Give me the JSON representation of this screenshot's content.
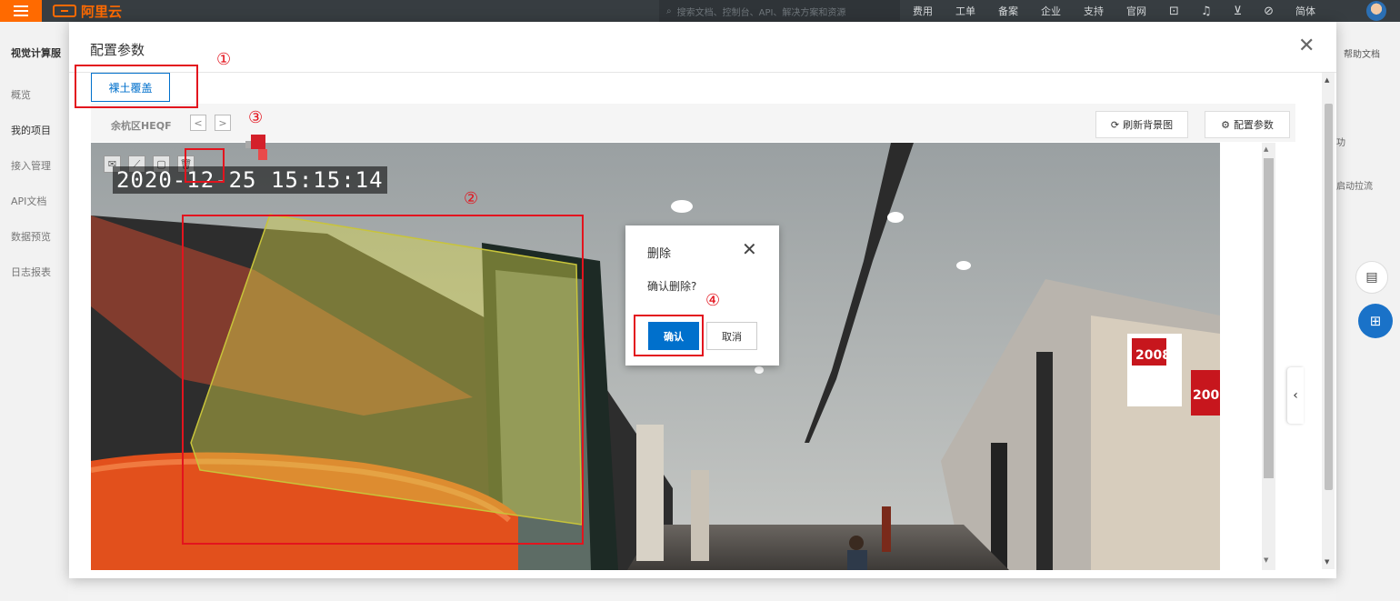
{
  "topbar": {
    "logo_text": "阿里云",
    "search_placeholder": "搜索文档、控制台、API、解决方案和资源",
    "nav": [
      "费用",
      "工单",
      "备案",
      "企业",
      "支持",
      "官网"
    ],
    "icons": [
      "terminal-icon",
      "bell-icon",
      "cart-icon",
      "help-icon"
    ],
    "lang": "简体"
  },
  "sidebar": {
    "title": "视觉计算服",
    "items": [
      "概览",
      "我的项目",
      "接入管理",
      "API文档",
      "数据预览",
      "日志报表"
    ],
    "active_index": 1
  },
  "right_panel": {
    "help": "帮助文档",
    "text1": "功",
    "text2": "启动拉流"
  },
  "dialog": {
    "title": "配置参数",
    "tab": "裸土覆盖",
    "camera_name": "余杭区HEQF",
    "prev": "<",
    "next": ">",
    "refresh_label": "刷新背景图",
    "config_label": "配置参数",
    "timestamp": "2020-12-25 15:15:14"
  },
  "scene_text": {
    "sign1": "2008",
    "sign2": "200"
  },
  "confirm": {
    "title": "删除",
    "message": "确认删除?",
    "ok": "确认",
    "cancel": "取消"
  },
  "annotations": [
    "①",
    "②",
    "③",
    "④"
  ],
  "colors": {
    "accent": "#0070cc",
    "brand": "#ff6a00",
    "annotation": "#e3141e",
    "polygon": "#d8d44a"
  }
}
